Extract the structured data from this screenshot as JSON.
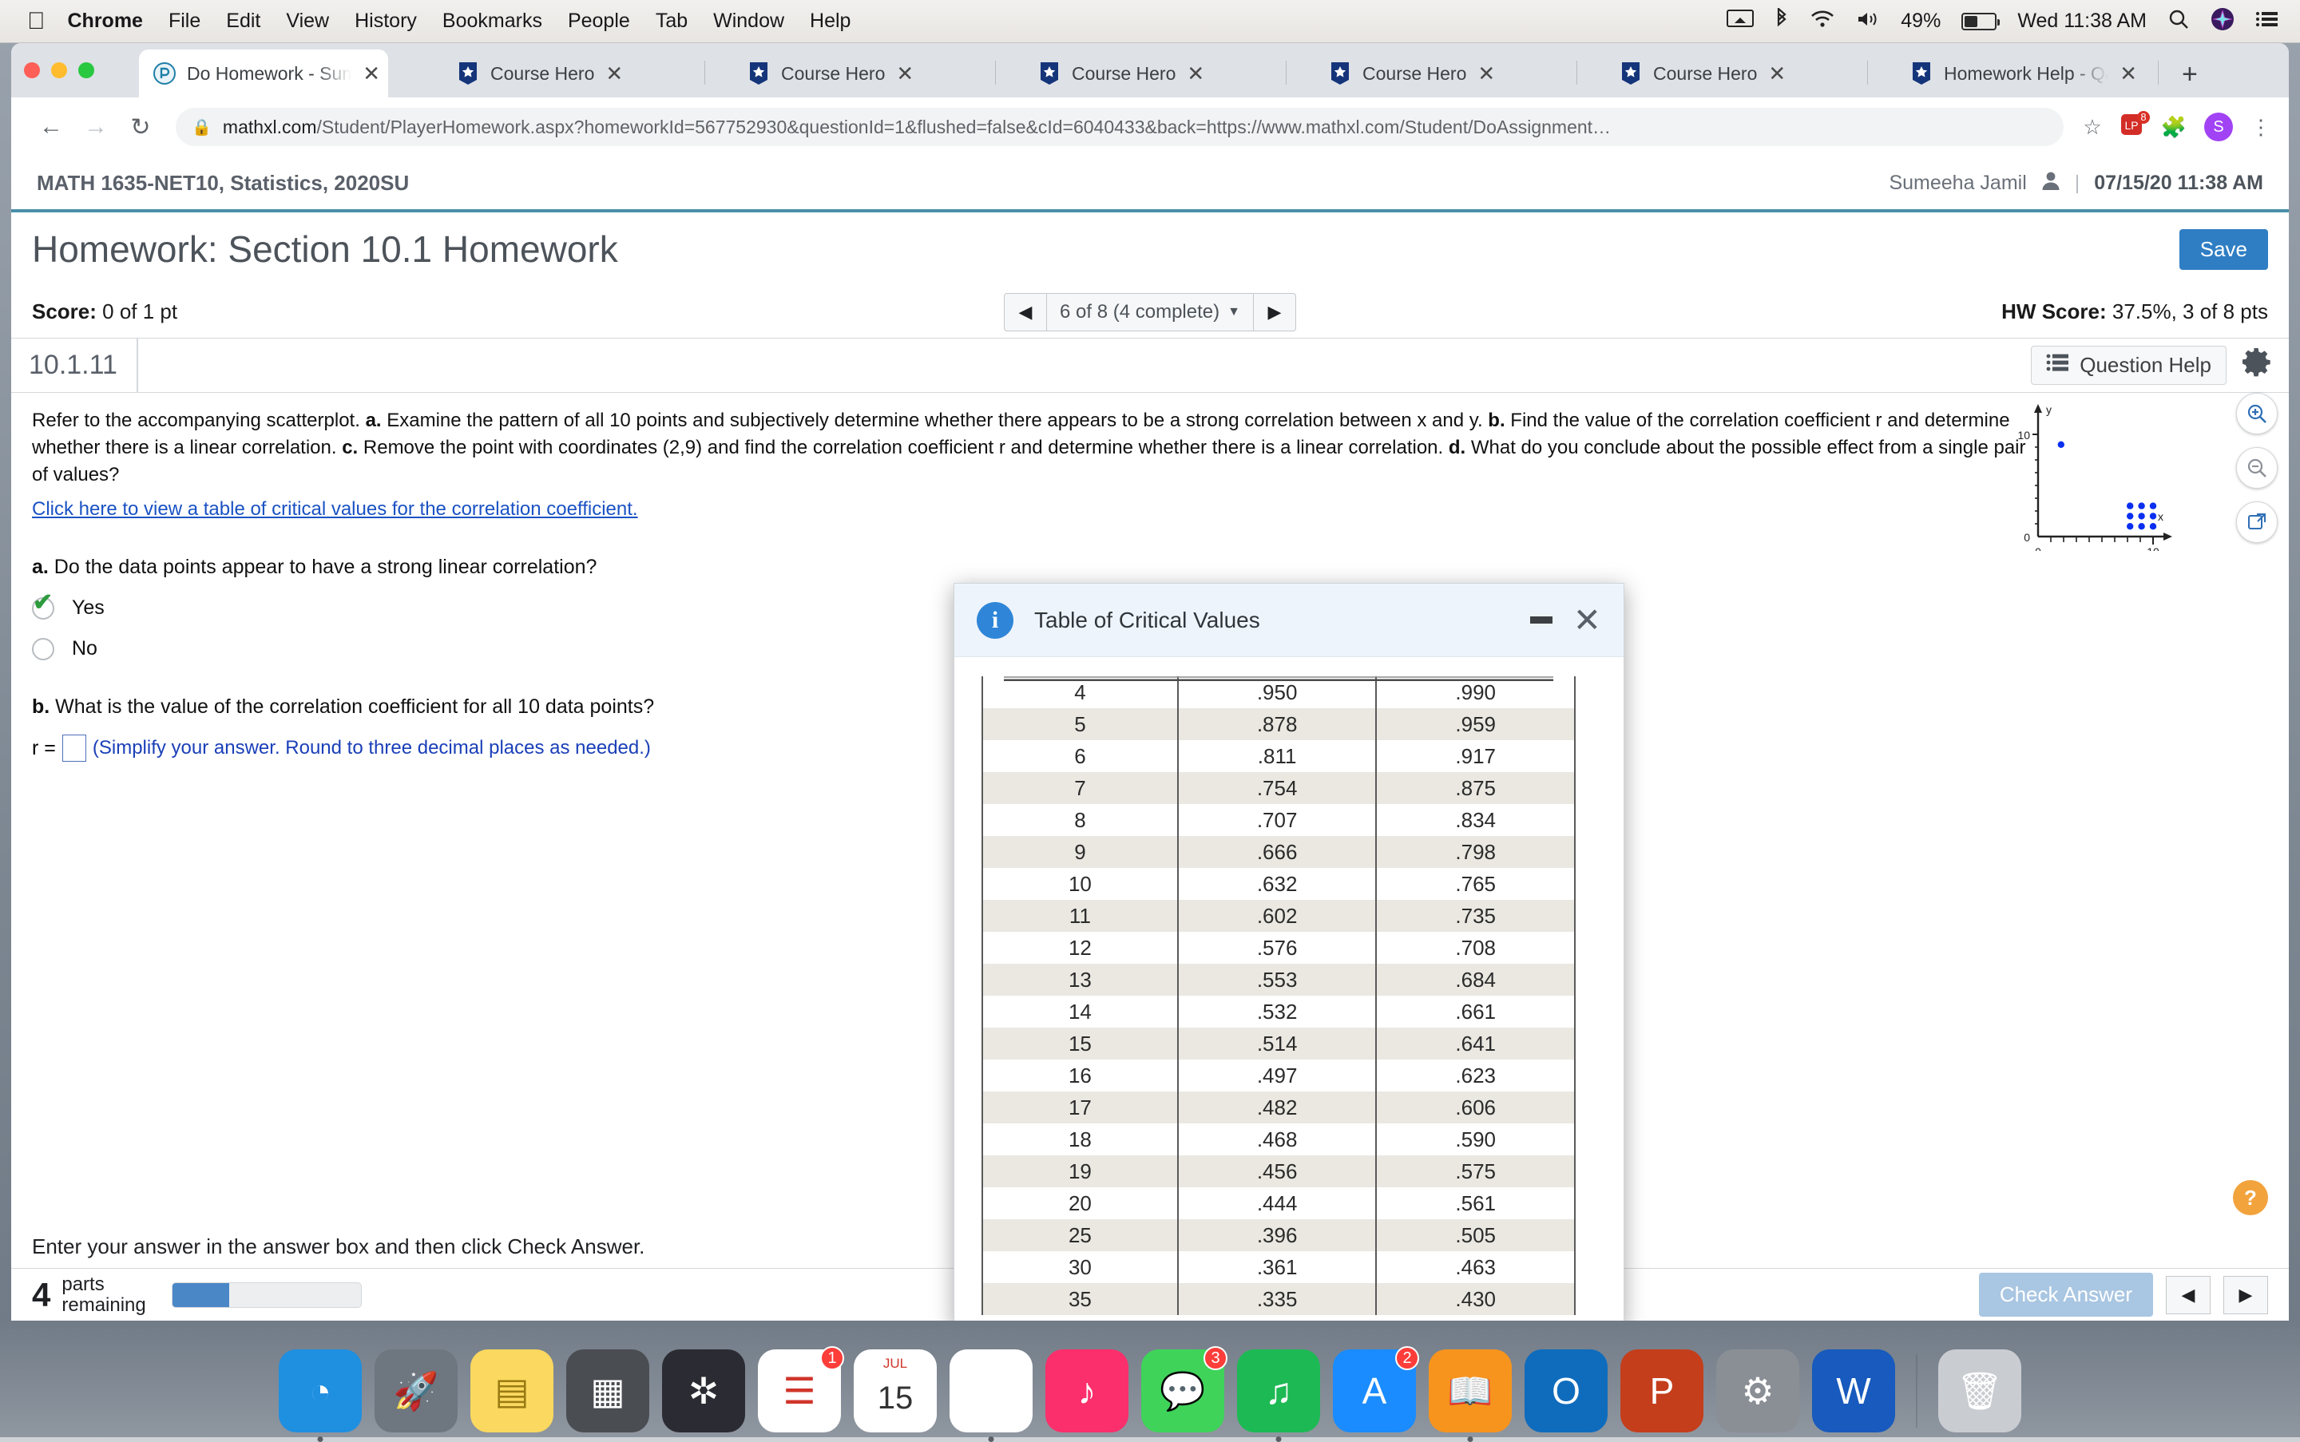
{
  "menubar": {
    "apple": "",
    "items": [
      "Chrome",
      "File",
      "Edit",
      "View",
      "History",
      "Bookmarks",
      "People",
      "Tab",
      "Window",
      "Help"
    ],
    "battery_pct": "49%",
    "clock": "Wed 11:38 AM"
  },
  "browser": {
    "tabs": [
      {
        "title": "Do Homework - Sum",
        "favicon": "pearson-icon",
        "active": true
      },
      {
        "title": "Course Hero",
        "favicon": "coursehero-icon",
        "active": false
      },
      {
        "title": "Course Hero",
        "favicon": "coursehero-icon",
        "active": false
      },
      {
        "title": "Course Hero",
        "favicon": "coursehero-icon",
        "active": false
      },
      {
        "title": "Course Hero",
        "favicon": "coursehero-icon",
        "active": false
      },
      {
        "title": "Course Hero",
        "favicon": "coursehero-icon",
        "active": false
      },
      {
        "title": "Homework Help - Q&",
        "favicon": "coursehero-icon",
        "active": false
      }
    ],
    "new_tab_label": "+",
    "url_host": "mathxl.com",
    "url_rest": "/Student/PlayerHomework.aspx?homeworkId=567752930&questionId=1&flushed=false&cId=6040433&back=https://www.mathxl.com/Student/DoAssignment…",
    "extension_badge": "8",
    "avatar_letter": "S"
  },
  "mathxl": {
    "course": "MATH 1635-NET10, Statistics, 2020SU",
    "user": "Sumeeha Jamil",
    "separator": "|",
    "datetime": "07/15/20 11:38 AM",
    "title": "Homework: Section 10.1 Homework",
    "save_label": "Save",
    "score_label": "Score:",
    "score_value": "0 of 1 pt",
    "hw_score_label": "HW Score:",
    "hw_score_value": "37.5%, 3 of 8 pts",
    "qnav_text": "6 of 8 (4 complete)",
    "question_number": "10.1.11",
    "question_help": "Question Help",
    "question_text_1": "Refer to the accompanying scatterplot. ",
    "question_a_tag": "a.",
    "question_text_2": " Examine the pattern of all 10 points and subjectively determine whether there appears to be a strong correlation between x and y. ",
    "question_b_tag": "b.",
    "question_text_3": " Find the value of the correlation coefficient r and determine whether there is a linear correlation. ",
    "question_c_tag": "c.",
    "question_text_4": " Remove the point with coordinates (2,9) and find the correlation coefficient r and determine whether there is a linear correlation. ",
    "question_d_tag": "d.",
    "question_text_5": " What do you conclude about the possible effect from a single pair of values?",
    "critical_link": "Click here to view a table of critical values for the correlation coefficient.",
    "part_a_tag": "a.",
    "part_a_text": " Do the data points appear to have a strong linear correlation?",
    "option_yes": "Yes",
    "option_no": "No",
    "selected_option": "Yes",
    "part_b_tag": "b.",
    "part_b_text": " What is the value of the correlation coefficient for all 10 data points?",
    "r_label": "r =",
    "r_value": "",
    "r_hint": "(Simplify your answer. Round to three decimal places as needed.)",
    "footer_message": "Enter your answer in the answer box and then click Check Answer.",
    "parts_number": "4",
    "parts_label_line1": "parts",
    "parts_label_line2": "remaining",
    "progress_pct": 30,
    "check_answer_label": "Check Answer",
    "help_badge": "?"
  },
  "modal": {
    "title": "Table of Critical Values",
    "info_icon": "i",
    "minimize_label": "–",
    "close_label": "×",
    "table": {
      "rows": [
        [
          "4",
          ".950",
          ".990"
        ],
        [
          "5",
          ".878",
          ".959"
        ],
        [
          "6",
          ".811",
          ".917"
        ],
        [
          "7",
          ".754",
          ".875"
        ],
        [
          "8",
          ".707",
          ".834"
        ],
        [
          "9",
          ".666",
          ".798"
        ],
        [
          "10",
          ".632",
          ".765"
        ],
        [
          "11",
          ".602",
          ".735"
        ],
        [
          "12",
          ".576",
          ".708"
        ],
        [
          "13",
          ".553",
          ".684"
        ],
        [
          "14",
          ".532",
          ".661"
        ],
        [
          "15",
          ".514",
          ".641"
        ],
        [
          "16",
          ".497",
          ".623"
        ],
        [
          "17",
          ".482",
          ".606"
        ],
        [
          "18",
          ".468",
          ".590"
        ],
        [
          "19",
          ".456",
          ".575"
        ],
        [
          "20",
          ".444",
          ".561"
        ],
        [
          "25",
          ".396",
          ".505"
        ],
        [
          "30",
          ".361",
          ".463"
        ],
        [
          "35",
          ".335",
          ".430"
        ]
      ]
    }
  },
  "chart_data": {
    "type": "scatter",
    "title": "",
    "xlabel": "x",
    "ylabel": "y",
    "xlim": [
      0,
      12
    ],
    "ylim": [
      0,
      12
    ],
    "xticks": [
      0,
      10
    ],
    "yticks": [
      0,
      10
    ],
    "grid": false,
    "point_color": "#0a2ff0",
    "points": [
      {
        "x": 2,
        "y": 9
      },
      {
        "x": 8,
        "y": 1
      },
      {
        "x": 9,
        "y": 1
      },
      {
        "x": 10,
        "y": 1
      },
      {
        "x": 8,
        "y": 2
      },
      {
        "x": 9,
        "y": 2
      },
      {
        "x": 10,
        "y": 2
      },
      {
        "x": 8,
        "y": 3
      },
      {
        "x": 9,
        "y": 3
      },
      {
        "x": 10,
        "y": 3
      }
    ],
    "n_points": 10
  },
  "plot_tools": {
    "zoom_in": "zoom-in-icon",
    "zoom_out": "zoom-out-icon",
    "expand": "expand-icon"
  },
  "dock": {
    "items": [
      {
        "name": "finder",
        "glyph": "◔",
        "color": "#1f8fe0",
        "badge": null,
        "running": true
      },
      {
        "name": "launchpad",
        "glyph": "🚀",
        "color": "#6e7680",
        "badge": null,
        "running": false
      },
      {
        "name": "notes",
        "glyph": "▤",
        "color": "#fbd85f",
        "badge": null,
        "running": false
      },
      {
        "name": "calculator",
        "glyph": "▦",
        "color": "#4a4d52",
        "badge": null,
        "running": false
      },
      {
        "name": "photos",
        "glyph": "✲",
        "color": "#2b2b33",
        "badge": null,
        "running": false
      },
      {
        "name": "reminders",
        "glyph": "☰",
        "color": "#ffffff",
        "badge": "1",
        "running": false
      },
      {
        "name": "calendar",
        "glyph": "15",
        "color": "#ffffff",
        "badge": null,
        "running": false,
        "sublabel": "JUL"
      },
      {
        "name": "chrome",
        "glyph": "◉",
        "color": "#ffffff",
        "badge": null,
        "running": true
      },
      {
        "name": "itunes",
        "glyph": "♪",
        "color": "#fb2f6b",
        "badge": null,
        "running": false
      },
      {
        "name": "messages",
        "glyph": "💬",
        "color": "#3fd35a",
        "badge": "3",
        "running": false
      },
      {
        "name": "spotify",
        "glyph": "♫",
        "color": "#1db954",
        "badge": null,
        "running": true
      },
      {
        "name": "app-store",
        "glyph": "A",
        "color": "#1a8cff",
        "badge": "2",
        "running": false
      },
      {
        "name": "books",
        "glyph": "📖",
        "color": "#f7941e",
        "badge": null,
        "running": true
      },
      {
        "name": "outlook",
        "glyph": "O",
        "color": "#0f6cbd",
        "badge": null,
        "running": false
      },
      {
        "name": "powerpoint",
        "glyph": "P",
        "color": "#c43e1c",
        "badge": null,
        "running": false
      },
      {
        "name": "system-preferences",
        "glyph": "⚙",
        "color": "#8a8f96",
        "badge": null,
        "running": false
      },
      {
        "name": "word",
        "glyph": "W",
        "color": "#185abd",
        "badge": null,
        "running": false
      },
      {
        "name": "trash",
        "glyph": "🗑",
        "color": "#c9ccd1",
        "badge": null,
        "running": false
      }
    ]
  }
}
